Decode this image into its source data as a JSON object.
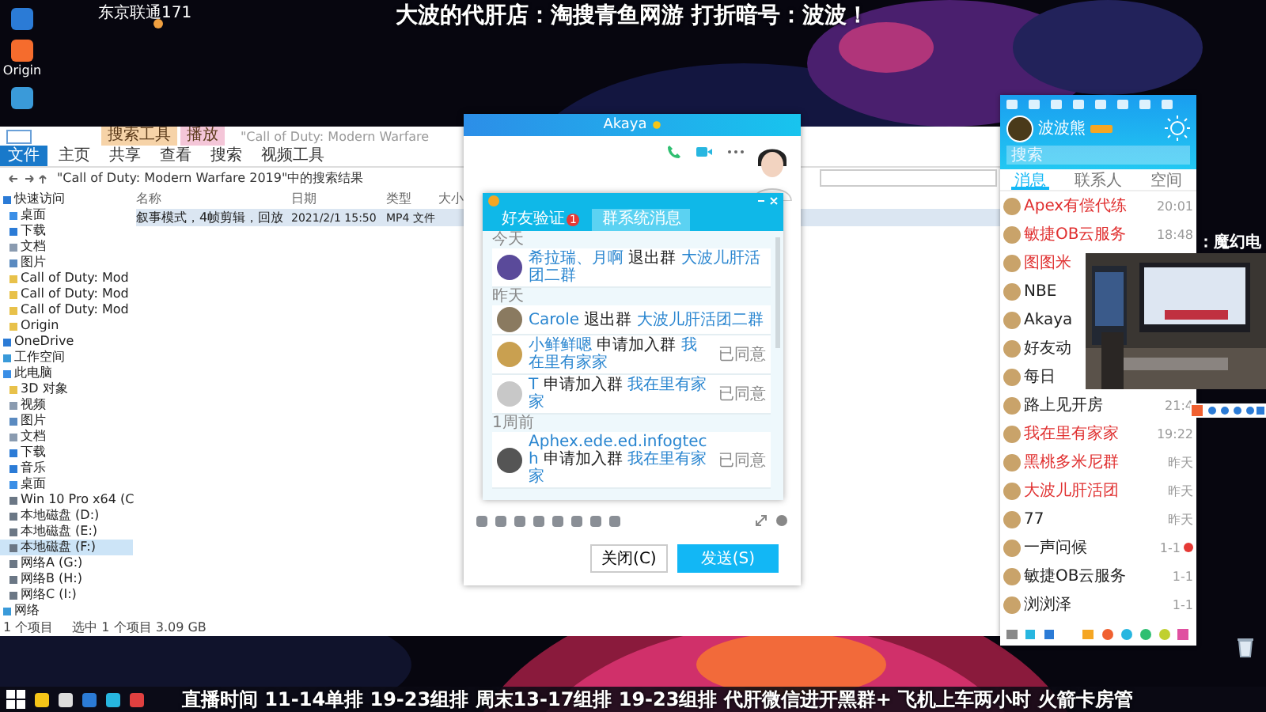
{
  "overlay": {
    "isp": "东京联通171",
    "banner": "大波的代肝店：淘搜青鱼网游 打折暗号：波波！",
    "side_caption": "：魔幻电",
    "ticker": "直播时间 11-14单排 19-23组排 周末13-17组排 19-23组排 代肝微信进开黑群+ 飞机上车两小时 火箭卡房管"
  },
  "desktop_icons": [
    {
      "kind": "computer"
    },
    {
      "kind": "origin",
      "label": "Origin"
    },
    {
      "kind": "network"
    }
  ],
  "explorer": {
    "title": "\"Call of Duty: Modern Warfare",
    "tool_headers": [
      {
        "label": "搜索工具",
        "kind": "search"
      },
      {
        "label": "播放",
        "kind": "video"
      }
    ],
    "tabs": [
      {
        "label": "文件",
        "selected": false,
        "kind": "file"
      },
      {
        "label": "主页",
        "selected": false,
        "kind": "plain"
      },
      {
        "label": "共享",
        "selected": false,
        "kind": "plain"
      },
      {
        "label": "查看",
        "selected": false,
        "kind": "plain"
      },
      {
        "label": "搜索",
        "selected": false,
        "kind": "search"
      },
      {
        "label": "视频工具",
        "selected": false,
        "kind": "video"
      }
    ],
    "address": "\"Call of Duty: Modern Warfare 2019\"中的搜索结果",
    "sidebar": [
      {
        "label": "快速访问",
        "kind": "star",
        "selected": false,
        "children": [
          {
            "label": "桌面",
            "kind": "desktop",
            "selected": false
          },
          {
            "label": "下载",
            "kind": "download",
            "selected": false
          },
          {
            "label": "文档",
            "kind": "doc",
            "selected": false
          },
          {
            "label": "图片",
            "selected": false
          },
          {
            "label": "Call of Duty: Mod",
            "kind": "folder",
            "selected": false
          },
          {
            "label": "Call of Duty: Mod",
            "kind": "folder",
            "selected": false
          },
          {
            "label": "Call of Duty: Mod",
            "kind": "folder",
            "selected": false
          },
          {
            "label": "Origin",
            "kind": "folder",
            "selected": false
          }
        ]
      },
      {
        "label": "OneDrive",
        "kind": "cloud",
        "selected": false
      },
      {
        "label": "工作空间",
        "kind": "network",
        "selected": false
      },
      {
        "label": "此电脑",
        "kind": "desktop",
        "selected": false,
        "children": [
          {
            "label": "3D 对象",
            "kind": "folder",
            "selected": false
          },
          {
            "label": "视频",
            "kind": "doc",
            "selected": false
          },
          {
            "label": "图片",
            "selected": false
          },
          {
            "label": "文档",
            "kind": "doc",
            "selected": false
          },
          {
            "label": "下载",
            "kind": "download",
            "selected": false
          },
          {
            "label": "音乐",
            "kind": "music",
            "selected": false
          },
          {
            "label": "桌面",
            "kind": "desktop",
            "selected": false
          },
          {
            "label": "Win 10 Pro x64 (C",
            "kind": "drive",
            "selected": false
          },
          {
            "label": "本地磁盘 (D:)",
            "kind": "drive",
            "selected": false
          },
          {
            "label": "本地磁盘 (E:)",
            "kind": "drive",
            "selected": false
          },
          {
            "label": "本地磁盘 (F:)",
            "kind": "drive",
            "selected": true
          },
          {
            "label": "网络A (G:)",
            "kind": "drive",
            "selected": false
          },
          {
            "label": "网络B (H:)",
            "kind": "drive",
            "selected": false
          },
          {
            "label": "网络C (I:)",
            "kind": "drive",
            "selected": false
          }
        ]
      },
      {
        "label": "网络",
        "kind": "network",
        "selected": false
      }
    ],
    "columns": [
      "名称",
      "日期",
      "类型",
      "大小"
    ],
    "rows": [
      {
        "name": "叙事模式，4帧剪辑，回放",
        "date": "2021/2/1 15:50",
        "type": "MP4 文件",
        "selected": true
      }
    ],
    "status": [
      "1 个项目",
      "选中 1 个项目 3.09 GB"
    ]
  },
  "chat": {
    "title": "Akaya",
    "dialog": {
      "tabs": [
        {
          "label": "好友验证",
          "selected": false,
          "badge": "1"
        },
        {
          "label": "群系统消息",
          "selected": true
        }
      ],
      "items": [
        {
          "kind": "section",
          "label": "今天"
        },
        {
          "kind": "request",
          "name": "希拉瑞、月啊",
          "action": "退出群",
          "group": "大波儿肝活团二群",
          "color": "#5a4a9a"
        },
        {
          "kind": "section",
          "label": "昨天"
        },
        {
          "kind": "request",
          "name": "Carole",
          "action": "退出群",
          "group": "大波儿肝活团二群",
          "color": "#8a7a60"
        },
        {
          "kind": "request",
          "name": "小鲜鲜嗯",
          "action": "申请加入群",
          "group": "我在里有家家",
          "status": "已同意",
          "color": "#c9a050"
        },
        {
          "kind": "request",
          "name": "T",
          "action": "申请加入群",
          "group": "我在里有家家",
          "status": "已同意",
          "color": "#c8c8c8"
        },
        {
          "kind": "section",
          "label": "1周前"
        },
        {
          "kind": "request",
          "name": "Aphex.ede.ed.infogtech",
          "action": "申请加入群",
          "group": "我在里有家家",
          "status": "已同意",
          "color": "#555555"
        }
      ]
    },
    "buttons": [
      {
        "label": "关闭(C)",
        "kind": "secondary"
      },
      {
        "label": "发送(S)",
        "kind": "primary"
      }
    ]
  },
  "qq": {
    "name": "波波熊",
    "search": {
      "placeholder": "搜索"
    },
    "tabs": [
      {
        "label": "消息",
        "selected": true
      },
      {
        "label": "联系人",
        "selected": false
      },
      {
        "label": "空间",
        "selected": false
      }
    ],
    "rows": [
      {
        "name": "Apex有偿代练",
        "time": "20:01",
        "highlighted": true,
        "unread": false
      },
      {
        "name": "敏捷OB云服务",
        "time": "18:48",
        "highlighted": true,
        "unread": false
      },
      {
        "name": "图图米",
        "highlighted": true
      },
      {
        "name": "NBE",
        "highlighted": false
      },
      {
        "name": "Akaya",
        "highlighted": false
      },
      {
        "name": "好友动",
        "highlighted": false
      },
      {
        "name": "每日",
        "highlighted": false
      },
      {
        "name": "路上见开房",
        "time": "21:4",
        "highlighted": false,
        "unread": false
      },
      {
        "name": "我在里有家家",
        "time": "19:22",
        "highlighted": true,
        "unread": false
      },
      {
        "name": "黑桃多米尼群",
        "time": "昨天",
        "highlighted": true,
        "unread": false
      },
      {
        "name": "大波儿肝活团",
        "time": "昨天",
        "highlighted": true,
        "unread": false
      },
      {
        "name": "77",
        "time": "昨天",
        "highlighted": false,
        "unread": false
      },
      {
        "name": "一声问候",
        "time": "1-1",
        "highlighted": false,
        "unread": true
      },
      {
        "name": "敏捷OB云服务",
        "time": "1-1",
        "highlighted": false,
        "unread": false
      },
      {
        "name": "浏浏泽",
        "time": "1-1",
        "highlighted": false,
        "unread": false
      }
    ]
  }
}
